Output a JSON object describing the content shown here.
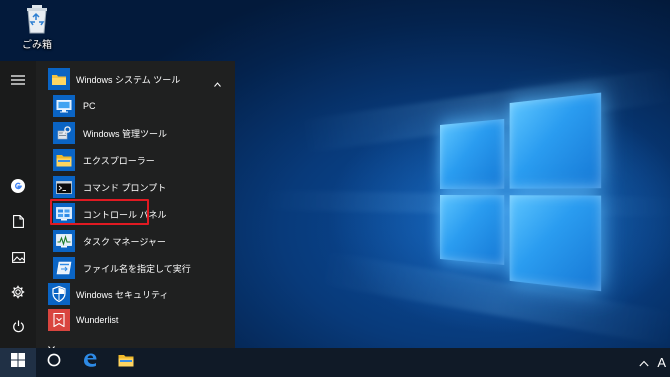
{
  "desktop": {
    "recycle_bin_label": "ごみ箱",
    "icons": {
      "recycle_bin": "recycle-bin-icon"
    }
  },
  "start_menu": {
    "rail": {
      "items": [
        {
          "name": "hamburger-menu",
          "icon": "hamburger-icon"
        },
        {
          "name": "user-account",
          "icon": "google-account-icon"
        },
        {
          "name": "documents",
          "icon": "document-icon"
        },
        {
          "name": "pictures",
          "icon": "picture-icon"
        },
        {
          "name": "settings",
          "icon": "gear-icon"
        },
        {
          "name": "power",
          "icon": "power-icon"
        }
      ]
    },
    "group": {
      "label": "Windows システム ツール",
      "icon": "folder-icon",
      "expanded": true
    },
    "apps": [
      {
        "label": "PC",
        "icon": "pc-icon"
      },
      {
        "label": "Windows 管理ツール",
        "icon": "admin-tools-icon"
      },
      {
        "label": "エクスプローラー",
        "icon": "explorer-folder-icon"
      },
      {
        "label": "コマンド プロンプト",
        "icon": "command-prompt-icon"
      },
      {
        "label": "コントロール パネル",
        "icon": "control-panel-icon",
        "highlighted": true
      },
      {
        "label": "タスク マネージャー",
        "icon": "task-manager-icon"
      },
      {
        "label": "ファイル名を指定して実行",
        "icon": "run-icon"
      },
      {
        "label": "Windows セキュリティ",
        "icon": "shield-icon"
      },
      {
        "label": "Wunderlist",
        "icon": "wunderlist-icon"
      }
    ],
    "colors": {
      "tile_blue": "#0a64c4",
      "wunderlist_red": "#d9453f",
      "highlight_border": "#e01a22"
    }
  },
  "taskbar": {
    "items": [
      {
        "name": "start-button",
        "icon": "windows-logo-icon"
      },
      {
        "name": "cortana-button",
        "icon": "cortana-circle-icon"
      },
      {
        "name": "edge-button",
        "icon": "edge-icon"
      },
      {
        "name": "file-explorer-button",
        "icon": "file-explorer-icon"
      }
    ],
    "tray": {
      "ime_indicator": "A",
      "chevron_icon": "chevron-up-icon"
    }
  }
}
